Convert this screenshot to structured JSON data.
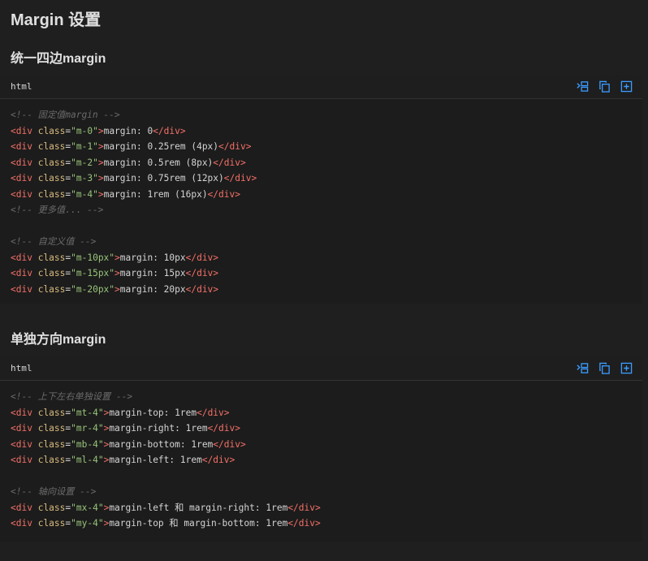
{
  "page": {
    "title": "Margin 设置"
  },
  "sections": [
    {
      "title": "统一四边margin",
      "language": "html",
      "lines": [
        [
          {
            "t": "comment",
            "v": "<!-- 固定值margin -->"
          }
        ],
        [
          {
            "t": "tag",
            "v": "<div"
          },
          {
            "t": "text",
            "v": " "
          },
          {
            "t": "attr",
            "v": "class"
          },
          {
            "t": "punct",
            "v": "="
          },
          {
            "t": "string",
            "v": "\"m-0\""
          },
          {
            "t": "tag",
            "v": ">"
          },
          {
            "t": "text",
            "v": "margin: 0"
          },
          {
            "t": "tag",
            "v": "</div>"
          }
        ],
        [
          {
            "t": "tag",
            "v": "<div"
          },
          {
            "t": "text",
            "v": " "
          },
          {
            "t": "attr",
            "v": "class"
          },
          {
            "t": "punct",
            "v": "="
          },
          {
            "t": "string",
            "v": "\"m-1\""
          },
          {
            "t": "tag",
            "v": ">"
          },
          {
            "t": "text",
            "v": "margin: 0.25rem (4px)"
          },
          {
            "t": "tag",
            "v": "</div>"
          }
        ],
        [
          {
            "t": "tag",
            "v": "<div"
          },
          {
            "t": "text",
            "v": " "
          },
          {
            "t": "attr",
            "v": "class"
          },
          {
            "t": "punct",
            "v": "="
          },
          {
            "t": "string",
            "v": "\"m-2\""
          },
          {
            "t": "tag",
            "v": ">"
          },
          {
            "t": "text",
            "v": "margin: 0.5rem (8px)"
          },
          {
            "t": "tag",
            "v": "</div>"
          }
        ],
        [
          {
            "t": "tag",
            "v": "<div"
          },
          {
            "t": "text",
            "v": " "
          },
          {
            "t": "attr",
            "v": "class"
          },
          {
            "t": "punct",
            "v": "="
          },
          {
            "t": "string",
            "v": "\"m-3\""
          },
          {
            "t": "tag",
            "v": ">"
          },
          {
            "t": "text",
            "v": "margin: 0.75rem (12px)"
          },
          {
            "t": "tag",
            "v": "</div>"
          }
        ],
        [
          {
            "t": "tag",
            "v": "<div"
          },
          {
            "t": "text",
            "v": " "
          },
          {
            "t": "attr",
            "v": "class"
          },
          {
            "t": "punct",
            "v": "="
          },
          {
            "t": "string",
            "v": "\"m-4\""
          },
          {
            "t": "tag",
            "v": ">"
          },
          {
            "t": "text",
            "v": "margin: 1rem (16px)"
          },
          {
            "t": "tag",
            "v": "</div>"
          }
        ],
        [
          {
            "t": "comment",
            "v": "<!-- 更多值... -->"
          }
        ],
        [],
        [
          {
            "t": "comment",
            "v": "<!-- 自定义值 -->"
          }
        ],
        [
          {
            "t": "tag",
            "v": "<div"
          },
          {
            "t": "text",
            "v": " "
          },
          {
            "t": "attr",
            "v": "class"
          },
          {
            "t": "punct",
            "v": "="
          },
          {
            "t": "string",
            "v": "\"m-10px\""
          },
          {
            "t": "tag",
            "v": ">"
          },
          {
            "t": "text",
            "v": "margin: 10px"
          },
          {
            "t": "tag",
            "v": "</div>"
          }
        ],
        [
          {
            "t": "tag",
            "v": "<div"
          },
          {
            "t": "text",
            "v": " "
          },
          {
            "t": "attr",
            "v": "class"
          },
          {
            "t": "punct",
            "v": "="
          },
          {
            "t": "string",
            "v": "\"m-15px\""
          },
          {
            "t": "tag",
            "v": ">"
          },
          {
            "t": "text",
            "v": "margin: 15px"
          },
          {
            "t": "tag",
            "v": "</div>"
          }
        ],
        [
          {
            "t": "tag",
            "v": "<div"
          },
          {
            "t": "text",
            "v": " "
          },
          {
            "t": "attr",
            "v": "class"
          },
          {
            "t": "punct",
            "v": "="
          },
          {
            "t": "string",
            "v": "\"m-20px\""
          },
          {
            "t": "tag",
            "v": ">"
          },
          {
            "t": "text",
            "v": "margin: 20px"
          },
          {
            "t": "tag",
            "v": "</div>"
          }
        ]
      ]
    },
    {
      "title": "单独方向margin",
      "language": "html",
      "lines": [
        [
          {
            "t": "comment",
            "v": "<!-- 上下左右单独设置 -->"
          }
        ],
        [
          {
            "t": "tag",
            "v": "<div"
          },
          {
            "t": "text",
            "v": " "
          },
          {
            "t": "attr",
            "v": "class"
          },
          {
            "t": "punct",
            "v": "="
          },
          {
            "t": "string",
            "v": "\"mt-4\""
          },
          {
            "t": "tag",
            "v": ">"
          },
          {
            "t": "text",
            "v": "margin-top: 1rem"
          },
          {
            "t": "tag",
            "v": "</div>"
          }
        ],
        [
          {
            "t": "tag",
            "v": "<div"
          },
          {
            "t": "text",
            "v": " "
          },
          {
            "t": "attr",
            "v": "class"
          },
          {
            "t": "punct",
            "v": "="
          },
          {
            "t": "string",
            "v": "\"mr-4\""
          },
          {
            "t": "tag",
            "v": ">"
          },
          {
            "t": "text",
            "v": "margin-right: 1rem"
          },
          {
            "t": "tag",
            "v": "</div>"
          }
        ],
        [
          {
            "t": "tag",
            "v": "<div"
          },
          {
            "t": "text",
            "v": " "
          },
          {
            "t": "attr",
            "v": "class"
          },
          {
            "t": "punct",
            "v": "="
          },
          {
            "t": "string",
            "v": "\"mb-4\""
          },
          {
            "t": "tag",
            "v": ">"
          },
          {
            "t": "text",
            "v": "margin-bottom: 1rem"
          },
          {
            "t": "tag",
            "v": "</div>"
          }
        ],
        [
          {
            "t": "tag",
            "v": "<div"
          },
          {
            "t": "text",
            "v": " "
          },
          {
            "t": "attr",
            "v": "class"
          },
          {
            "t": "punct",
            "v": "="
          },
          {
            "t": "string",
            "v": "\"ml-4\""
          },
          {
            "t": "tag",
            "v": ">"
          },
          {
            "t": "text",
            "v": "margin-left: 1rem"
          },
          {
            "t": "tag",
            "v": "</div>"
          }
        ],
        [],
        [
          {
            "t": "comment",
            "v": "<!-- 轴向设置 -->"
          }
        ],
        [
          {
            "t": "tag",
            "v": "<div"
          },
          {
            "t": "text",
            "v": " "
          },
          {
            "t": "attr",
            "v": "class"
          },
          {
            "t": "punct",
            "v": "="
          },
          {
            "t": "string",
            "v": "\"mx-4\""
          },
          {
            "t": "tag",
            "v": ">"
          },
          {
            "t": "text",
            "v": "margin-left 和 margin-right: 1rem"
          },
          {
            "t": "tag",
            "v": "</div>"
          }
        ],
        [
          {
            "t": "tag",
            "v": "<div"
          },
          {
            "t": "text",
            "v": " "
          },
          {
            "t": "attr",
            "v": "class"
          },
          {
            "t": "punct",
            "v": "="
          },
          {
            "t": "string",
            "v": "\"my-4\""
          },
          {
            "t": "tag",
            "v": ">"
          },
          {
            "t": "text",
            "v": "margin-top 和 margin-bottom: 1rem"
          },
          {
            "t": "tag",
            "v": "</div>"
          }
        ]
      ]
    }
  ],
  "toolbar": {
    "icons": [
      "wrap-lines-icon",
      "copy-icon",
      "expand-icon"
    ],
    "icon_color": "#3b9cff"
  }
}
